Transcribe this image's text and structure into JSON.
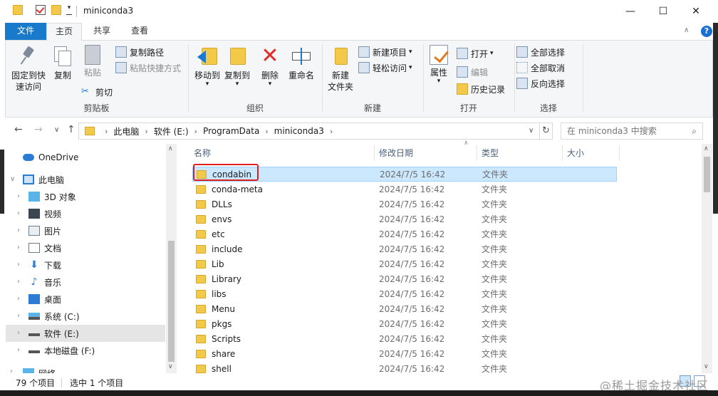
{
  "window": {
    "title": "miniconda3",
    "minimize": "—",
    "maximize": "☐",
    "close": "✕"
  },
  "ribbon_tabs": [
    "文件",
    "主页",
    "共享",
    "查看"
  ],
  "ribbon": {
    "clipboard": {
      "pin_label": "固定到快速访问",
      "pin_line1": "固定到快",
      "pin_line2": "速访问",
      "copy": "复制",
      "paste": "粘贴",
      "copy_path": "复制路径",
      "paste_shortcut": "粘贴快捷方式",
      "cut": "剪切",
      "group": "剪贴板"
    },
    "organize": {
      "move_to": "移动到",
      "copy_to": "复制到",
      "delete": "删除",
      "rename": "重命名",
      "group": "组织"
    },
    "new": {
      "new_folder_line1": "新建",
      "new_folder_line2": "文件夹",
      "new_item": "新建项目",
      "easy_access": "轻松访问",
      "group": "新建"
    },
    "open": {
      "properties": "属性",
      "open": "打开",
      "edit": "编辑",
      "history": "历史记录",
      "group": "打开"
    },
    "select": {
      "select_all": "全部选择",
      "select_none": "全部取消",
      "invert": "反向选择",
      "group": "选择"
    }
  },
  "address": {
    "crumbs": [
      "此电脑",
      "软件 (E:)",
      "ProgramData",
      "miniconda3"
    ],
    "search_placeholder": "在 miniconda3 中搜索"
  },
  "nav": {
    "items": [
      {
        "label": "OneDrive",
        "icon": "cloud-icon"
      },
      {
        "label": "此电脑",
        "icon": "computer-icon"
      },
      {
        "label": "3D 对象",
        "icon": "cube-icon"
      },
      {
        "label": "视频",
        "icon": "video-icon"
      },
      {
        "label": "图片",
        "icon": "picture-icon"
      },
      {
        "label": "文档",
        "icon": "document-icon"
      },
      {
        "label": "下载",
        "icon": "download-icon"
      },
      {
        "label": "音乐",
        "icon": "music-icon"
      },
      {
        "label": "桌面",
        "icon": "desktop-icon"
      },
      {
        "label": "系统 (C:)",
        "icon": "drive-icon"
      },
      {
        "label": "软件 (E:)",
        "icon": "drive-icon"
      },
      {
        "label": "本地磁盘 (F:)",
        "icon": "drive-icon"
      },
      {
        "label": "网络",
        "icon": "network-icon"
      }
    ]
  },
  "columns": {
    "name": "名称",
    "modified": "修改日期",
    "type": "类型",
    "size": "大小"
  },
  "files": [
    {
      "name": "condabin",
      "date": "2024/7/5 16:42",
      "type": "文件夹"
    },
    {
      "name": "conda-meta",
      "date": "2024/7/5 16:42",
      "type": "文件夹"
    },
    {
      "name": "DLLs",
      "date": "2024/7/5 16:42",
      "type": "文件夹"
    },
    {
      "name": "envs",
      "date": "2024/7/5 16:42",
      "type": "文件夹"
    },
    {
      "name": "etc",
      "date": "2024/7/5 16:42",
      "type": "文件夹"
    },
    {
      "name": "include",
      "date": "2024/7/5 16:42",
      "type": "文件夹"
    },
    {
      "name": "Lib",
      "date": "2024/7/5 16:42",
      "type": "文件夹"
    },
    {
      "name": "Library",
      "date": "2024/7/5 16:42",
      "type": "文件夹"
    },
    {
      "name": "libs",
      "date": "2024/7/5 16:42",
      "type": "文件夹"
    },
    {
      "name": "Menu",
      "date": "2024/7/5 16:42",
      "type": "文件夹"
    },
    {
      "name": "pkgs",
      "date": "2024/7/5 16:42",
      "type": "文件夹"
    },
    {
      "name": "Scripts",
      "date": "2024/7/5 16:42",
      "type": "文件夹"
    },
    {
      "name": "share",
      "date": "2024/7/5 16:42",
      "type": "文件夹"
    },
    {
      "name": "shell",
      "date": "2024/7/5 16:42",
      "type": "文件夹"
    }
  ],
  "status": {
    "count": "79 个项目",
    "selection": "选中 1 个项目"
  },
  "watermark": "@稀土掘金技术社区",
  "colors": {
    "accent": "#1979ca",
    "selection": "#cce8ff",
    "highlight_box": "#e02020"
  }
}
